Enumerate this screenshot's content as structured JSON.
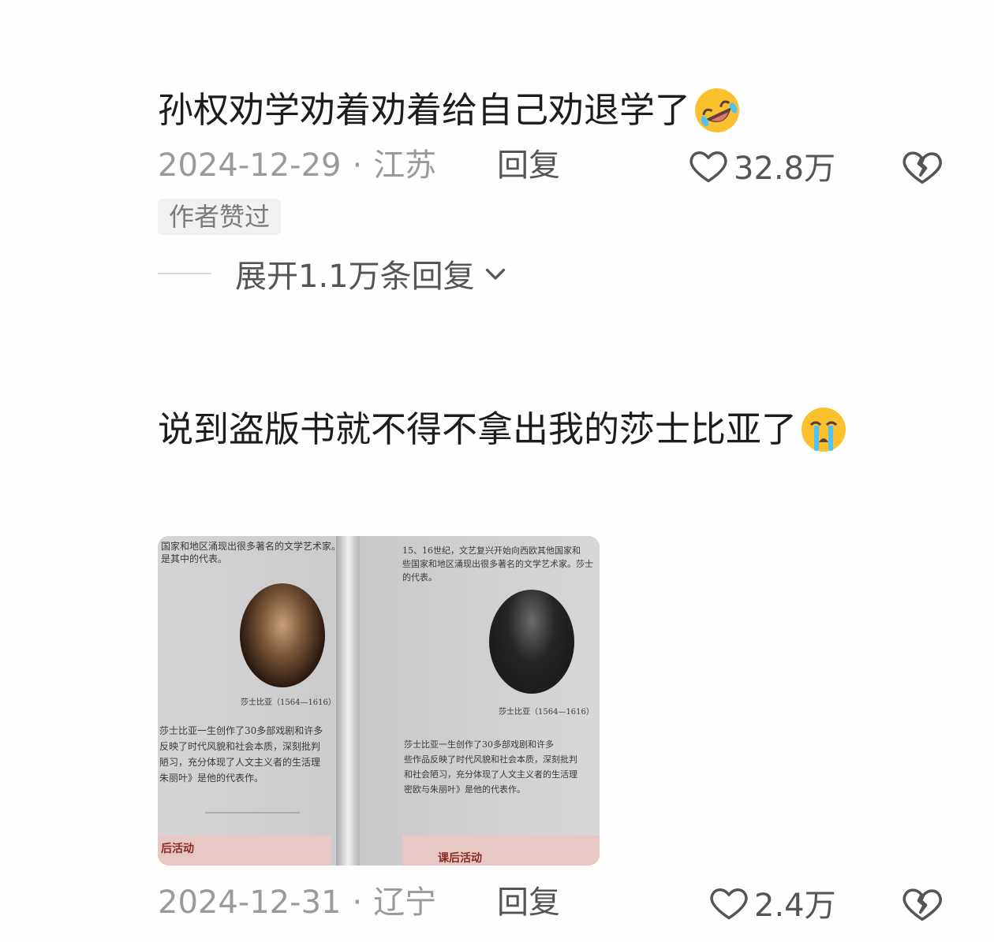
{
  "comments": [
    {
      "text": "孙权劝学劝着劝着给自己劝退学了",
      "emoji": "rolling-on-floor-laughing",
      "date": "2024-12-29",
      "location": "江苏",
      "reply_label": "回复",
      "likes": "32.8万",
      "badge": "作者赞过",
      "expand_label": "展开1.1万条回复"
    },
    {
      "text": "说到盗版书就不得不拿出我的莎士比亚了",
      "emoji": "loudly-crying-face",
      "date": "2024-12-31",
      "location": "辽宁",
      "reply_label": "回复",
      "likes": "2.4万",
      "photo": {
        "left_lines": [
          "国家和地区涌现出很多著名的文学艺术家。",
          "是其中的代表。"
        ],
        "right_lines": [
          "15、16世纪，文艺复兴开始向西欧其他国家和",
          "些国家和地区涌现出很多著名的文学艺术家。莎士",
          "的代表。"
        ],
        "caption_left": "莎士比亚（1564—1616）",
        "caption_right": "莎士比亚（1564—1616）",
        "body_left": [
          "莎士比亚一生创作了30多部戏剧和许多",
          "反映了时代风貌和社会本质，深刻批判",
          "陋习，充分体现了人文主义者的生活理",
          "朱丽叶》是他的代表作。"
        ],
        "body_right": [
          "莎士比亚一生创作了30多部戏剧和许多",
          "些作品反映了时代风貌和社会本质，深刻批判",
          "和社会陋习，充分体现了人文主义者的生活理",
          "密欧与朱丽叶》是他的代表作。"
        ],
        "band_left": "后活动",
        "band_right": "课后活动"
      }
    }
  ],
  "colors": {
    "meta": "#9a9a9a",
    "text": "#1c1c1c",
    "badge_bg": "#f1f1f1"
  }
}
